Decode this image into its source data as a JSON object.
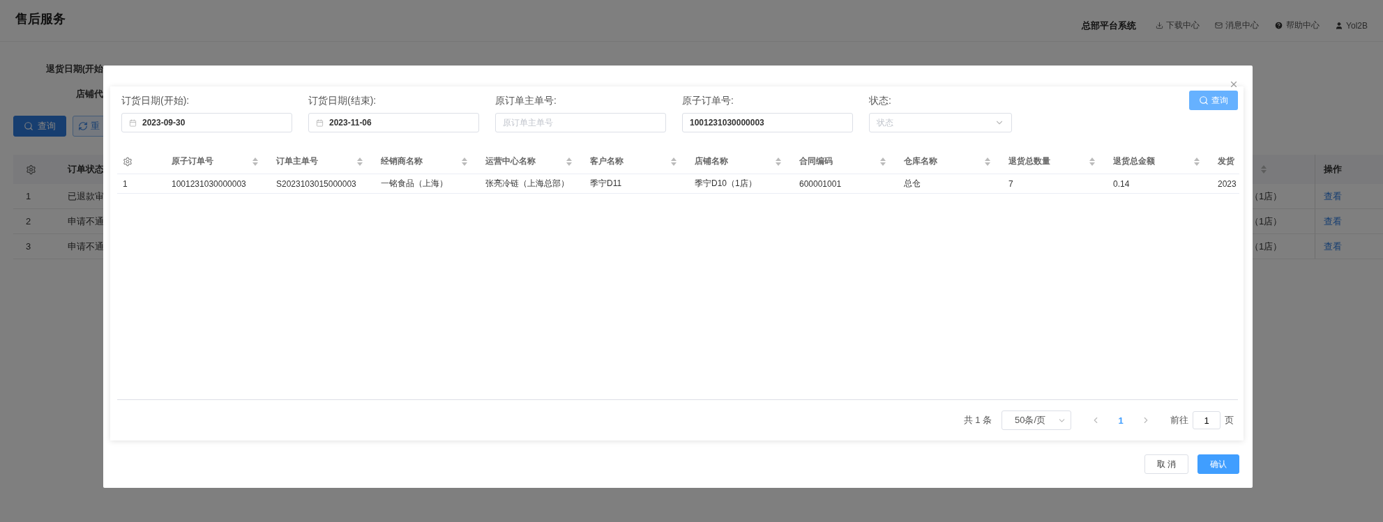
{
  "page": {
    "title": "售后服务",
    "system_name": "总部平台系统",
    "links": [
      {
        "kind": "download",
        "label": "下载中心"
      },
      {
        "kind": "mail",
        "label": "消息中心"
      },
      {
        "kind": "help",
        "label": "帮助中心"
      },
      {
        "kind": "user",
        "label": "Yol2B"
      }
    ]
  },
  "background_filters": [
    "退货日期(开始",
    "店铺代"
  ],
  "background_buttons": [
    {
      "kind": "search",
      "label": "查询"
    },
    {
      "kind": "reset",
      "label": "重"
    }
  ],
  "background_table": {
    "status_column": "订单状态",
    "action_column": "操作",
    "rows": [
      {
        "index": "1",
        "status": "已退款审",
        "store": "（1店）",
        "action": "查看"
      },
      {
        "index": "2",
        "status": "申请不通",
        "store": "（1店）",
        "action": "查看"
      },
      {
        "index": "3",
        "status": "申请不通",
        "store": "（1店）",
        "action": "查看"
      }
    ]
  },
  "dialog": {
    "filters": [
      {
        "kind": "date",
        "label": "订货日期(开始):",
        "value": "2023-09-30"
      },
      {
        "kind": "date",
        "label": "订货日期(结束):",
        "value": "2023-11-06"
      },
      {
        "kind": "text",
        "label": "原订单主单号:",
        "placeholder": "原订单主单号"
      },
      {
        "kind": "text",
        "label": "原子订单号:",
        "value": "1001231030000003"
      },
      {
        "kind": "select",
        "label": "状态:",
        "placeholder": "状态"
      }
    ],
    "search_button": "查询",
    "table": {
      "columns": [
        "原子订单号",
        "订单主单号",
        "经销商名称",
        "运营中心名称",
        "客户名称",
        "店铺名称",
        "合同编码",
        "仓库名称",
        "退货总数量",
        "退货总金额",
        "发货"
      ],
      "rows": [
        {
          "index": "1",
          "cells": [
            "1001231030000003",
            "S2023103015000003",
            "一铭食品（上海）",
            "张亮冷链（上海总部）",
            "季宁D11",
            "季宁D10（1店）",
            "600001001",
            "总仓",
            "7",
            "0.14",
            "2023"
          ]
        }
      ]
    },
    "pagination": {
      "total": "共 1 条",
      "page_size": "50条/页",
      "pages": [
        {
          "label": "1",
          "selected": true
        }
      ],
      "goto_label": "前往",
      "goto_value": "1",
      "goto_suffix": "页"
    },
    "buttons": [
      {
        "kind": "default",
        "label": "取 消"
      },
      {
        "kind": "primary",
        "label": "确认"
      }
    ]
  }
}
